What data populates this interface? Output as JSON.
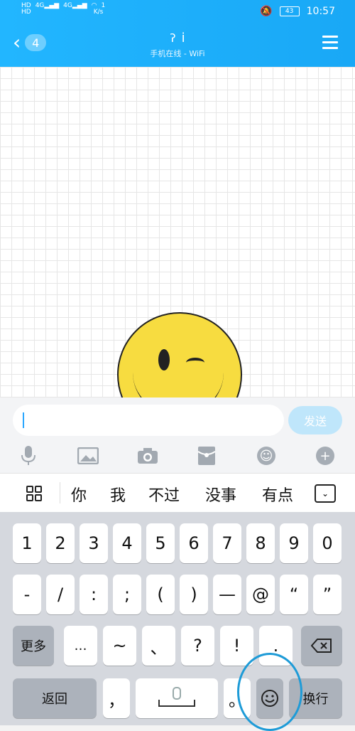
{
  "status": {
    "net_speed": "1",
    "net_unit": "K/s",
    "battery": "43",
    "time": "10:57"
  },
  "header": {
    "unread_count": "4",
    "contact_name": "i",
    "subtitle": "手机在线 - WiFi"
  },
  "input": {
    "value": "",
    "send_label": "发送"
  },
  "toolbar": {
    "icons": [
      "voice-icon",
      "image-icon",
      "camera-icon",
      "red-packet-icon",
      "emoji-icon",
      "plus-icon"
    ]
  },
  "candidates": {
    "words": [
      "你",
      "我",
      "不过",
      "没事",
      "有点"
    ]
  },
  "keyboard": {
    "row1": [
      "1",
      "2",
      "3",
      "4",
      "5",
      "6",
      "7",
      "8",
      "9",
      "0"
    ],
    "row2": [
      "-",
      "/",
      ":",
      ";",
      "(",
      ")",
      "—",
      "@",
      "“",
      "”"
    ],
    "row3": {
      "more": "更多",
      "keys": [
        "…",
        "~",
        "、",
        "?",
        "!",
        "."
      ]
    },
    "row4": {
      "back": "返回",
      "comma": "，",
      "period": "。",
      "enter": "换行"
    }
  },
  "colors": {
    "accent": "#22b6ff",
    "send_disabled": "#bfe6fb",
    "annotation": "#1e9bd7"
  }
}
